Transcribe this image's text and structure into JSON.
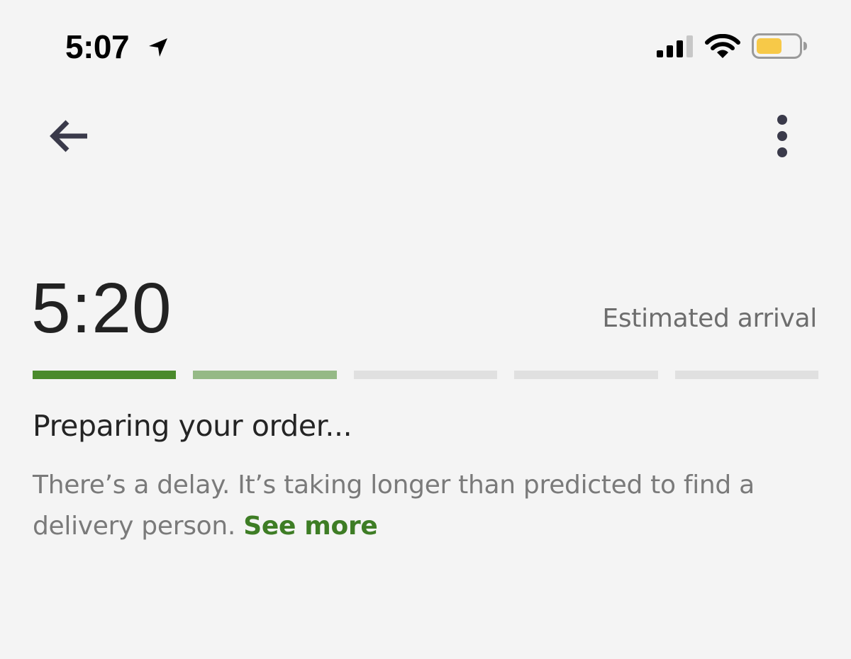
{
  "status_bar": {
    "time": "5:07",
    "icons": [
      "location-arrow-icon",
      "cellular-signal-icon",
      "wifi-icon",
      "battery-icon"
    ],
    "battery_color": "#f7c948"
  },
  "nav": {
    "back_icon": "arrow-left-icon",
    "menu_icon": "vertical-ellipsis-icon"
  },
  "eta": {
    "time": "5:20",
    "label": "Estimated arrival"
  },
  "progress": {
    "segments": [
      {
        "state": "complete",
        "color": "#4a8a2c"
      },
      {
        "state": "in-progress",
        "color": "#95b986"
      },
      {
        "state": "pending",
        "color": "#e0e0e0"
      },
      {
        "state": "pending",
        "color": "#e0e0e0"
      },
      {
        "state": "pending",
        "color": "#e0e0e0"
      }
    ]
  },
  "status": {
    "heading": "Preparing your order...",
    "message": "There’s a delay. It’s taking longer than predicted to find a delivery person.",
    "see_more_label": "See more"
  },
  "colors": {
    "accent_green": "#3e7d25",
    "background": "#f4f4f4"
  }
}
